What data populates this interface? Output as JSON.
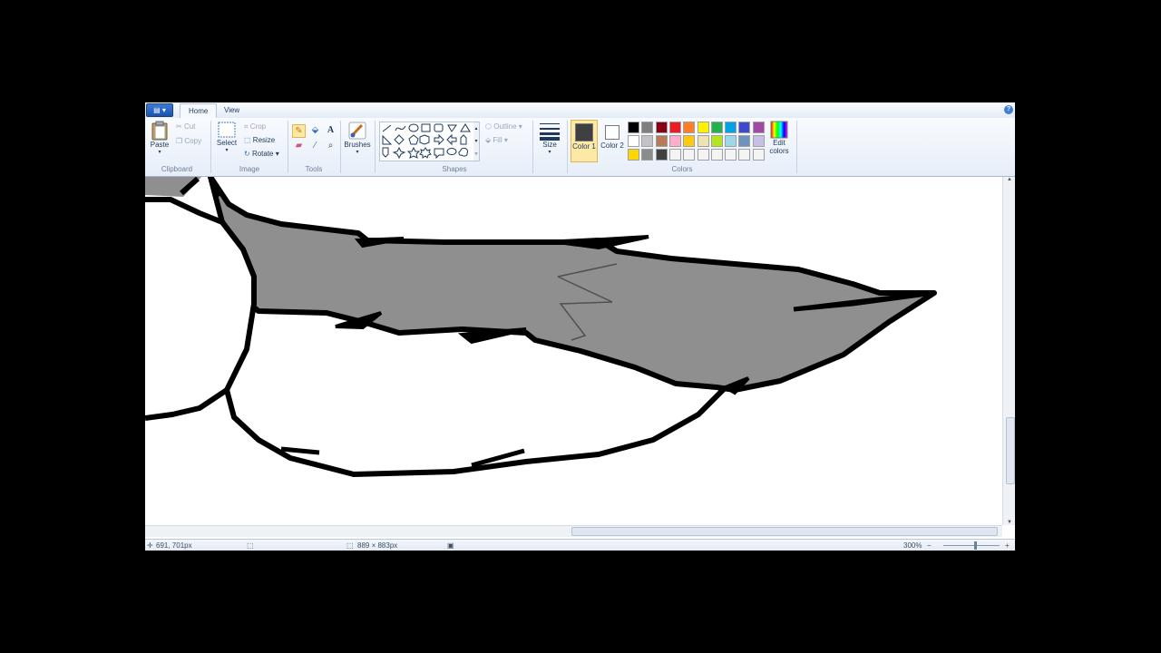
{
  "tabs": {
    "app_menu": "▤ ▾",
    "home": "Home",
    "view": "View",
    "help": "?"
  },
  "clipboard": {
    "paste": "Paste",
    "cut": "Cut",
    "copy": "Copy",
    "group": "Clipboard"
  },
  "image": {
    "select": "Select",
    "crop": "Crop",
    "resize": "Resize",
    "rotate": "Rotate",
    "group": "Image"
  },
  "tools": {
    "group": "Tools"
  },
  "brushes": {
    "label": "Brushes"
  },
  "shapes": {
    "outline": "Outline",
    "fill": "Fill",
    "group": "Shapes"
  },
  "size": {
    "label": "Size"
  },
  "colors": {
    "color1_label": "Color 1",
    "color2_label": "Color 2",
    "edit_label": "Edit colors",
    "group": "Colors",
    "color1_value": "#404040",
    "color2_value": "#ffffff",
    "palette_row1": [
      "#000000",
      "#7f7f7f",
      "#880015",
      "#ed1c24",
      "#ff7f27",
      "#fff200",
      "#22b14c",
      "#00a2e8",
      "#3f48cc",
      "#a349a4"
    ],
    "palette_row2": [
      "#ffffff",
      "#c3c3c3",
      "#b97a57",
      "#ffaec9",
      "#ffc90e",
      "#efe4b0",
      "#b5e61d",
      "#99d9ea",
      "#7092be",
      "#c8bfe7"
    ],
    "palette_row3": [
      "#ffd700",
      "#8c8c8c",
      "#404040",
      "#f4f4f4",
      "#f4f4f4",
      "#f4f4f4",
      "#f4f4f4",
      "#f4f4f4",
      "#f4f4f4",
      "#f4f4f4"
    ]
  },
  "status": {
    "cursor_pos": "691, 701px",
    "image_size": "889 × 883px",
    "zoom": "300%"
  },
  "drawing": {
    "fill_color": "#8f8f8f",
    "stroke_color": "#000000"
  }
}
